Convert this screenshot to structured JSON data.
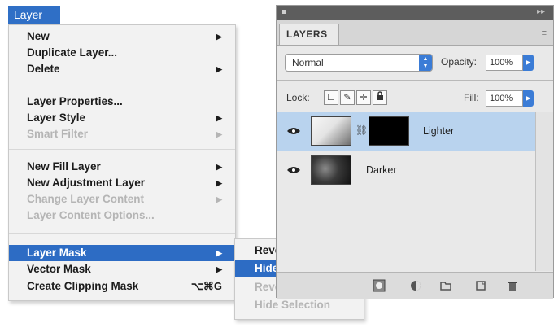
{
  "menu": {
    "title": "Layer",
    "items": [
      {
        "label": "New",
        "arrow": "▶",
        "disabled": false
      },
      {
        "label": "Duplicate Layer...",
        "disabled": false
      },
      {
        "label": "Delete",
        "arrow": "▶",
        "disabled": false
      },
      {
        "label": "Layer Properties...",
        "disabled": false
      },
      {
        "label": "Layer Style",
        "arrow": "▶",
        "disabled": false
      },
      {
        "label": "Smart Filter",
        "arrow": "▶",
        "disabled": true
      },
      {
        "label": "New Fill Layer",
        "arrow": "▶",
        "disabled": false
      },
      {
        "label": "New Adjustment Layer",
        "arrow": "▶",
        "disabled": false
      },
      {
        "label": "Change Layer Content",
        "arrow": "▶",
        "disabled": true
      },
      {
        "label": "Layer Content Options...",
        "disabled": true
      },
      {
        "label": "Layer Mask",
        "arrow": "▶",
        "highlighted": true
      },
      {
        "label": "Vector Mask",
        "arrow": "▶",
        "disabled": false
      },
      {
        "label": "Create Clipping Mask",
        "shortcut": "⌥⌘G",
        "disabled": false
      }
    ]
  },
  "submenu": {
    "items": [
      {
        "label": "Reveal All",
        "disabled": false
      },
      {
        "label": "Hide All",
        "highlighted": true
      },
      {
        "label": "Reveal Selection",
        "disabled": true
      },
      {
        "label": "Hide Selection",
        "disabled": true
      }
    ]
  },
  "panel": {
    "tab": "LAYERS",
    "blend_mode": "Normal",
    "opacity_label": "Opacity:",
    "opacity_value": "100%",
    "lock_label": "Lock:",
    "fill_label": "Fill:",
    "fill_value": "100%",
    "layers": [
      {
        "name": "Lighter",
        "selected": true,
        "has_mask": true
      },
      {
        "name": "Darker",
        "selected": false,
        "has_mask": false
      }
    ]
  },
  "colors": {
    "highlight": "#2d6cc4",
    "selected_layer": "#b9d3ee"
  }
}
